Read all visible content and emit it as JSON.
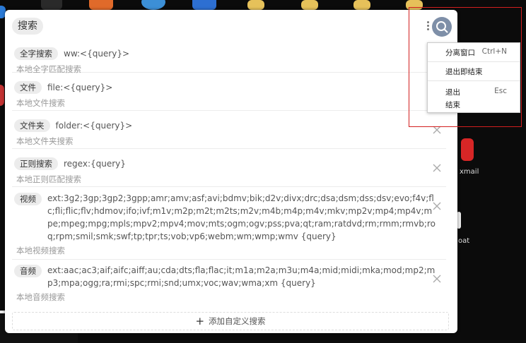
{
  "header": {
    "title": "搜索",
    "more_icon": "more-vertical-icon",
    "search_icon": "search-icon"
  },
  "items": [
    {
      "tag": "全字搜索",
      "query": "ww:<{query}>",
      "desc": "本地全字匹配搜索",
      "closable": false
    },
    {
      "tag": "文件",
      "query": "file:<{query}>",
      "desc": "本地文件搜索",
      "closable": false
    },
    {
      "tag": "文件夹",
      "query": "folder:<{query}>",
      "desc": "本地文件夹搜索",
      "closable": true
    },
    {
      "tag": "正则搜索",
      "query": "regex:{query}",
      "desc": "本地正则匹配搜索",
      "closable": true
    },
    {
      "tag": "视频",
      "query": "ext:3g2;3gp;3gp2;3gpp;amr;amv;asf;avi;bdmv;bik;d2v;divx;drc;dsa;dsm;dss;dsv;evo;f4v;flc;fli;flic;flv;hdmov;ifo;ivf;m1v;m2p;m2t;m2ts;m2v;m4b;m4p;m4v;mkv;mp2v;mp4;mp4v;mpe;mpeg;mpg;mpls;mpv2;mpv4;mov;mts;ogm;ogv;pss;pva;qt;ram;ratdvd;rm;rmm;rmvb;roq;rpm;smil;smk;swf;tp;tpr;ts;vob;vp6;webm;wm;wmp;wmv {query}",
      "desc": "本地视频搜索",
      "closable": true
    },
    {
      "tag": "音频",
      "query": "ext:aac;ac3;aif;aifc;aiff;au;cda;dts;fla;flac;it;m1a;m2a;m3u;m4a;mid;midi;mka;mod;mp2;mp3;mpa;ogg;ra;rmi;spc;rmi;snd;umx;voc;wav;wma;xm {query}",
      "desc": "本地音频搜索",
      "closable": true
    }
  ],
  "add_button": {
    "label": "添加自定义搜索",
    "icon": "plus-icon"
  },
  "menu": {
    "items": [
      {
        "label": "分离窗口",
        "shortcut": "Ctrl+N"
      },
      {
        "label": "退出即结束",
        "shortcut": ""
      },
      {
        "label": "退出",
        "shortcut": "Esc"
      },
      {
        "label": "结束",
        "shortcut": ""
      }
    ]
  },
  "desktop": {
    "label1": "xmail",
    "label2": "oat"
  },
  "colors": {
    "accent": "#7e8fa8",
    "highlight_box": "#d21f1f",
    "tag_bg": "#ececec"
  }
}
